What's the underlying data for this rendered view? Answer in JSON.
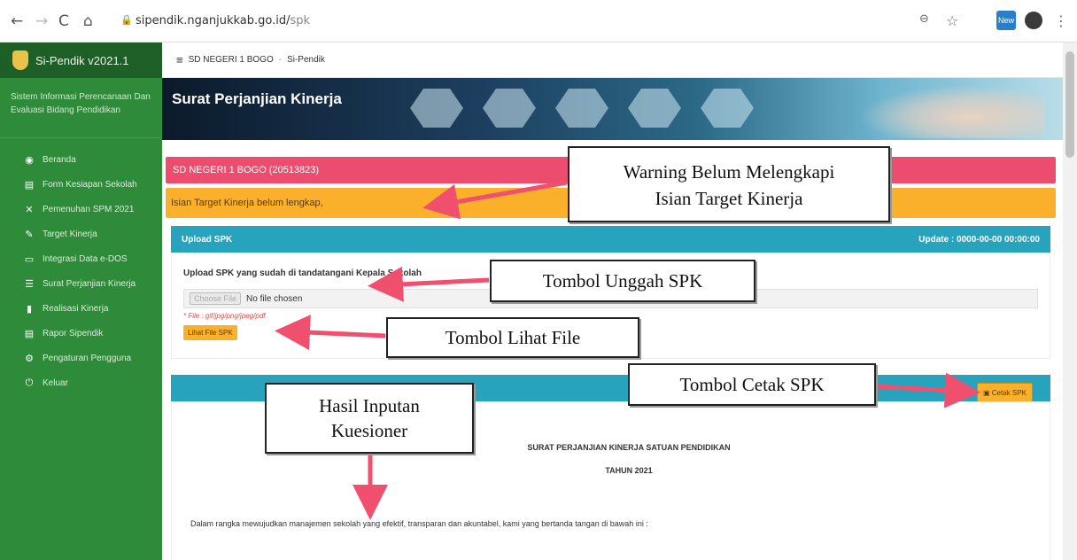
{
  "browser": {
    "back": "←",
    "forward": "→",
    "reload": "C",
    "home": "⌂",
    "url_host": "sipendik.nganjukkab.go.id/",
    "url_path": "spk",
    "zoom_icon": "⊖",
    "star_icon": "☆",
    "ext_label": "New",
    "puzzle_icon": "✱",
    "menu_icon": "⋮"
  },
  "sidebar": {
    "brand": "Si-Pendik v2021.1",
    "subtitle": "Sistem Informasi Perencanaan Dan Evaluasi Bidang Pendidikan",
    "items": [
      {
        "icon": "dashboard-icon",
        "glyph": "◉",
        "label": "Beranda"
      },
      {
        "icon": "file-icon",
        "glyph": "▤",
        "label": "Form Kesiapan Sekolah"
      },
      {
        "icon": "tools-icon",
        "glyph": "✕",
        "label": "Pemenuhan SPM 2021"
      },
      {
        "icon": "edit-icon",
        "glyph": "✎",
        "label": "Target Kinerja"
      },
      {
        "icon": "monitor-icon",
        "glyph": "▭",
        "label": "Integrasi Data e-DOS"
      },
      {
        "icon": "list-icon",
        "glyph": "☰",
        "label": "Surat Perjanjian Kinerja"
      },
      {
        "icon": "file-icon",
        "glyph": "▮",
        "label": "Realisasi Kinerja"
      },
      {
        "icon": "report-icon",
        "glyph": "▤",
        "label": "Rapor Sipendik"
      },
      {
        "icon": "users-gear-icon",
        "glyph": "⚙",
        "label": "Pengaturan Pengguna"
      },
      {
        "icon": "power-icon",
        "glyph": "⏻",
        "label": "Keluar"
      }
    ]
  },
  "topbar": {
    "menu_icon": "≡",
    "school": "SD NEGERI 1 BOGO",
    "separator": "-",
    "app": "Si-Pendik"
  },
  "banner": {
    "title": "Surat Perjanjian Kinerja"
  },
  "alerts": {
    "school_line": "SD NEGERI 1 BOGO (20513823)",
    "warning": "Isian Target Kinerja belum lengkap,"
  },
  "upload_card": {
    "header": "Upload SPK",
    "update": "Update : 0000-00-00 00:00:00",
    "label": "Upload SPK yang sudah di tandatangani Kepala Sekolah",
    "choose": "Choose File",
    "no_file": "No file chosen",
    "hint": "* File : gif/jpg/png/jpeg/pdf",
    "lihat": "Lihat File SPK"
  },
  "document": {
    "cetak": "Cetak SPK",
    "title": "SURAT PERJANJIAN KINERJA SATUAN PENDIDIKAN",
    "year": "TAHUN 2021",
    "paragraph": "Dalam rangka mewujudkan manajemen sekolah yang efektif, transparan dan akuntabel, kami yang bertanda tangan di bawah ini :"
  },
  "annotations": {
    "warning_line1": "Warning Belum Melengkapi",
    "warning_line2": "Isian Target Kinerja",
    "unggah": "Tombol Unggah SPK",
    "lihat": "Tombol Lihat File",
    "cetak": "Tombol Cetak SPK",
    "hasil_line1": "Hasil Inputan",
    "hasil_line2": "Kuesioner"
  },
  "colors": {
    "sidebar": "#2e8b3a",
    "alert_red": "#ec4d6f",
    "alert_yellow": "#fbb02b",
    "card_header": "#27a3bd",
    "arrow": "#f0506e"
  }
}
